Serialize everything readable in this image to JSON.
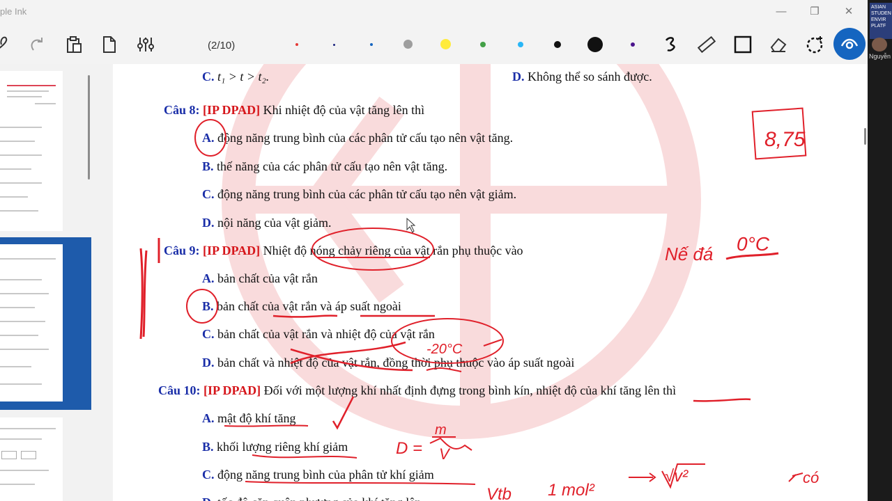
{
  "window": {
    "title": "ple Ink",
    "controls": {
      "minimize": "—",
      "maximize": "❐",
      "close": "✕"
    }
  },
  "toolbar": {
    "page_indicator": "(2/10)",
    "icons": [
      "lasso-icon",
      "redo-icon",
      "clipboard-icon",
      "new-page-icon",
      "settings-sliders-icon",
      "pen-icon",
      "ruler-icon",
      "rectangle-icon",
      "eraser-icon",
      "select-icon",
      "view-icon"
    ],
    "colors": [
      "#e53935",
      "#1a237e",
      "#1565c0",
      "#9e9e9e",
      "#ffeb3b",
      "#43a047",
      "#29b6f6",
      "#111111",
      "#111111",
      "#4a148c"
    ]
  },
  "video": {
    "name": "Nguyễn",
    "banner": "ASIAN STUDEN ENVIR PLATF"
  },
  "document": {
    "lines": {
      "q7c": "C.",
      "q7c_text": "t₁ > t > t₂.",
      "q7d": "D.",
      "q7d_text": "Không thể so sánh được.",
      "q8_num": "Câu 8:",
      "q8_tag": "[IP DPAD]",
      "q8_text": "Khi nhiệt độ của vật tăng lên thì",
      "q8a": "A.",
      "q8a_text": "động năng trung bình của các phân tử cấu tạo nên vật tăng.",
      "q8b": "B.",
      "q8b_text": "thế năng của các phân tử cấu tạo nên vật tăng.",
      "q8c": "C.",
      "q8c_text": "động năng trung bình của các phân tử cấu tạo nên vật giảm.",
      "q8d": "D.",
      "q8d_text": "nội năng của vật giảm.",
      "q9_num": "Câu 9:",
      "q9_tag": "[IP DPAD]",
      "q9_text": "Nhiệt độ nóng chảy riêng của vật rắn phụ thuộc vào",
      "q9a": "A.",
      "q9a_text": "bản chất của vật rắn",
      "q9b": "B.",
      "q9b_text": "bản chất của vật rắn và áp suất ngoài",
      "q9c": "C.",
      "q9c_text": "bản chất của vật rắn và nhiệt độ của vật rắn",
      "q9d": "D.",
      "q9d_text": "bản chất và nhiệt độ của vật rắn, đồng thời phụ thuộc vào áp suất ngoài",
      "q10_num": "Câu 10:",
      "q10_tag": "[IP DPAD]",
      "q10_text": "Đối với một lượng khí nhất định đựng trong bình kín, nhiệt độ của khí tăng lên thì",
      "q10a": "A.",
      "q10a_text": "mật độ khí tăng",
      "q10b": "B.",
      "q10b_text": "khối lượng riêng khí giảm",
      "q10c": "C.",
      "q10c_text": "động năng trung bình của phân tử khí giảm",
      "q10d": "D.",
      "q10d_text": "tốc độ căn quân phương của khí tăng lên"
    },
    "handwriting": {
      "score": "8,75",
      "note_melt": "Nế đá",
      "note_zero": "0°C",
      "note_minus20": "-20°C",
      "formula_D": "D =",
      "formula_m": "m",
      "formula_V": "V",
      "note_vtb": "Vtb",
      "note_1mol": "1 mol²",
      "note_sqrt": "√v²",
      "note_co": "có"
    }
  }
}
